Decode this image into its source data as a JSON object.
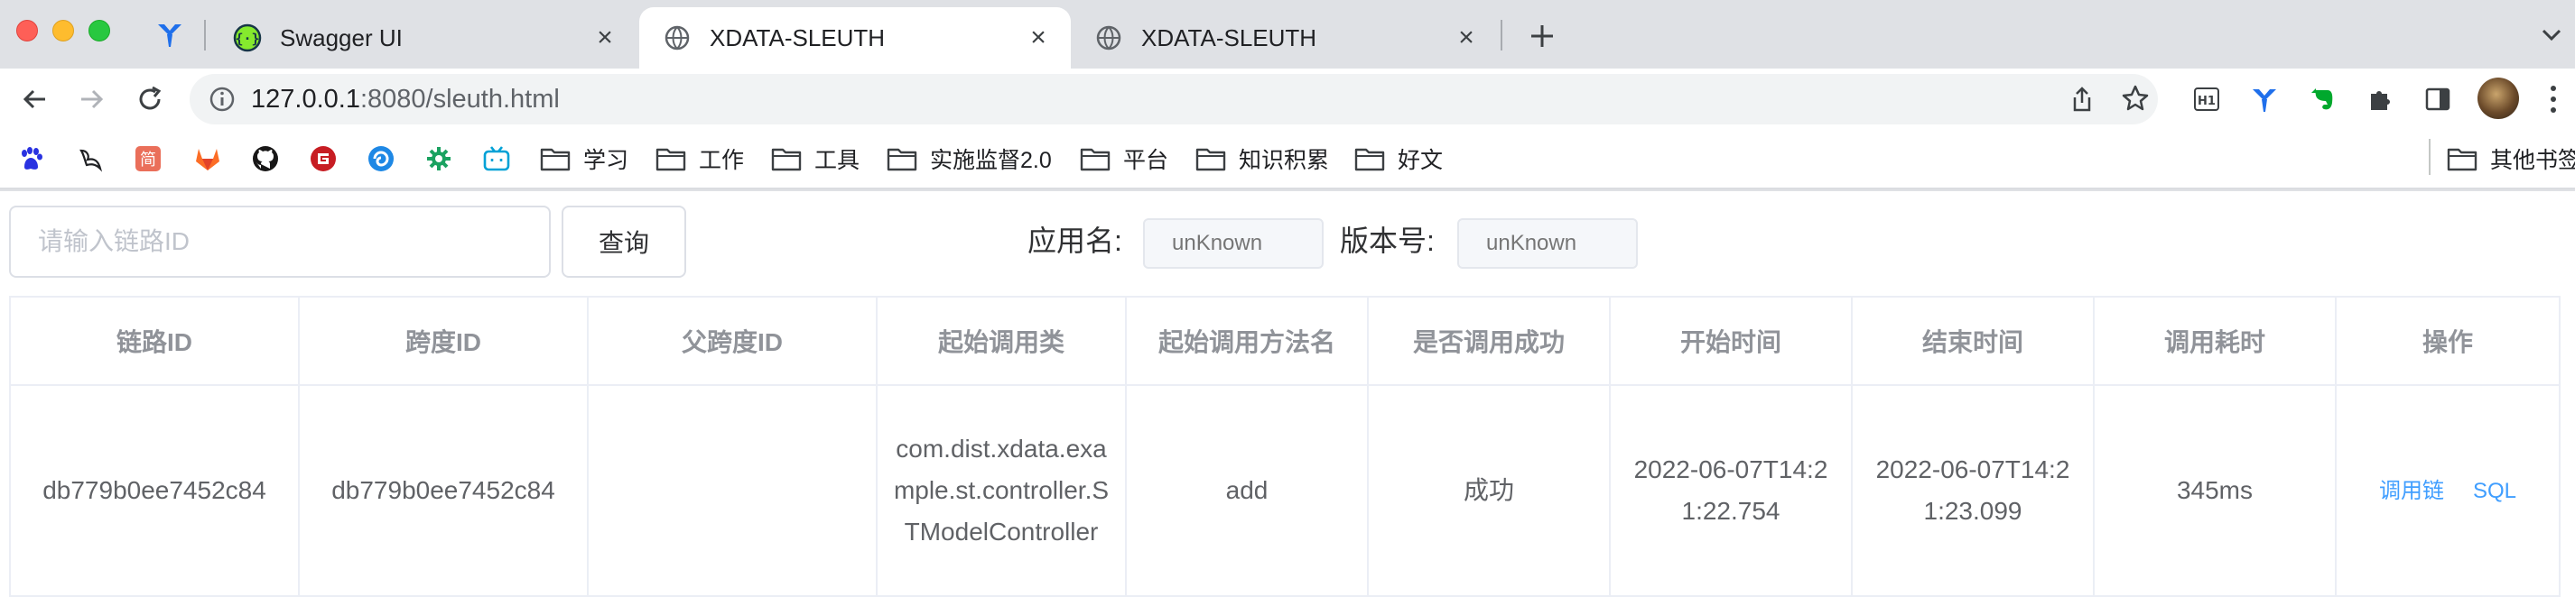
{
  "browser": {
    "tabs": [
      {
        "title": "Swagger UI",
        "active": false
      },
      {
        "title": "XDATA-SLEUTH",
        "active": true
      },
      {
        "title": "XDATA-SLEUTH",
        "active": false
      }
    ],
    "url": {
      "host": "127.0.0.1",
      "rest": ":8080/sleuth.html"
    },
    "bookmarks": [
      {
        "icon": "baidu-icon"
      },
      {
        "icon": "yuque-icon"
      },
      {
        "icon": "jianshu-icon"
      },
      {
        "icon": "gitlab-icon"
      },
      {
        "icon": "github-icon"
      },
      {
        "icon": "gitee-icon"
      },
      {
        "icon": "swirl-icon"
      },
      {
        "icon": "gear-green-icon"
      },
      {
        "icon": "bilibili-icon"
      },
      {
        "icon": "folder-icon",
        "label": "学习"
      },
      {
        "icon": "folder-icon",
        "label": "工作"
      },
      {
        "icon": "folder-icon",
        "label": "工具"
      },
      {
        "icon": "folder-icon",
        "label": "实施监督2.0"
      },
      {
        "icon": "folder-icon",
        "label": "平台"
      },
      {
        "icon": "folder-icon",
        "label": "知识积累"
      },
      {
        "icon": "folder-icon",
        "label": "好文"
      }
    ],
    "other_bookmarks": "其他书签"
  },
  "search": {
    "placeholder": "请输入链路ID",
    "button": "查询",
    "app_label": "应用名:",
    "app_value": "unKnown",
    "version_label": "版本号:",
    "version_value": "unKnown"
  },
  "table": {
    "columns": [
      "链路ID",
      "跨度ID",
      "父跨度ID",
      "起始调用类",
      "起始调用方法名",
      "是否调用成功",
      "开始时间",
      "结束时间",
      "调用耗时",
      "操作"
    ],
    "rows": [
      {
        "trace_id": "db779b0ee7452c84",
        "span_id": "db779b0ee7452c84",
        "parent_span_id": "",
        "class": "com.dist.xdata.example.st.controller.STModelController",
        "method": "add",
        "success": "成功",
        "start": "2022-06-07T14:21:22.754",
        "end": "2022-06-07T14:21:23.099",
        "duration": "345ms",
        "actions": [
          "调用链",
          "SQL"
        ]
      }
    ]
  },
  "colors": {
    "accent": "#409eff",
    "header_text": "#909399",
    "cell_text": "#606266",
    "border": "#ebeef5"
  }
}
